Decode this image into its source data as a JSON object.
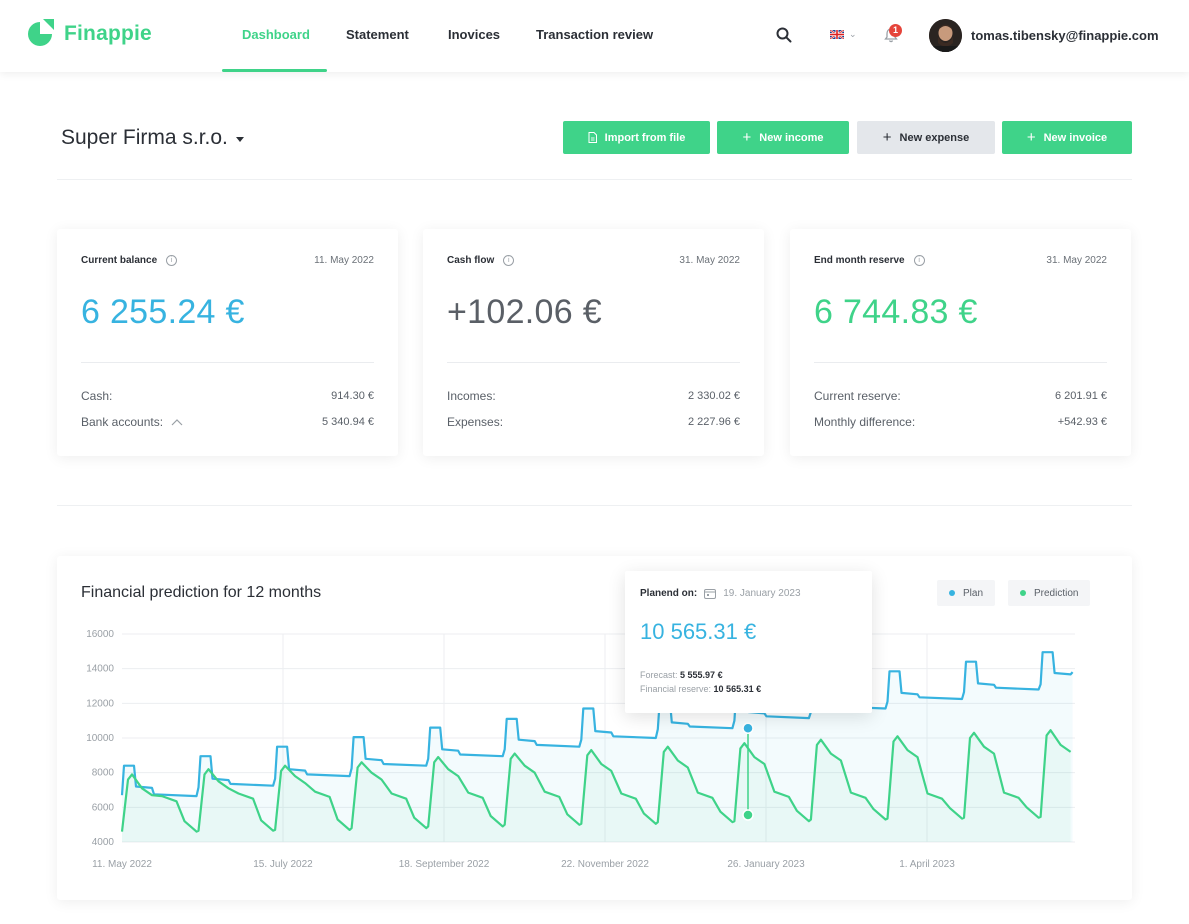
{
  "app": {
    "name": "Finappie",
    "brand_color": "#3fd389",
    "accent_blue": "#37b3e0"
  },
  "nav": {
    "items": [
      {
        "label": "Dashboard",
        "active": true
      },
      {
        "label": "Statement",
        "active": false
      },
      {
        "label": "Inovices",
        "active": false
      },
      {
        "label": "Transaction review",
        "active": false
      }
    ]
  },
  "header": {
    "search_icon": "search-icon",
    "language_icon": "uk-flag-icon",
    "notifications_count": "1",
    "user_email": "tomas.tibensky@finappie.com"
  },
  "company": {
    "name": "Super Firma s.r.o."
  },
  "actions": {
    "import": "Import from file",
    "new_income": "New income",
    "new_expense": "New expense",
    "new_invoice": "New invoice"
  },
  "cards": {
    "balance": {
      "title": "Current balance",
      "date": "11. May 2022",
      "value": "6 255.24 €",
      "color": "#37b3e0",
      "rows": [
        {
          "label": "Cash:",
          "value": "914.30 €"
        },
        {
          "label": "Bank accounts:",
          "value": "5 340.94 €"
        }
      ]
    },
    "cashflow": {
      "title": "Cash flow",
      "date": "31. May 2022",
      "value": "+102.06 €",
      "color": "#5a5f66",
      "rows": [
        {
          "label": "Incomes:",
          "value": "2 330.02 €"
        },
        {
          "label": "Expenses:",
          "value": "2 227.96 €"
        }
      ]
    },
    "reserve": {
      "title": "End month reserve",
      "date": "31. May 2022",
      "value": "6 744.83 €",
      "color": "#3fd389",
      "rows": [
        {
          "label": "Current reserve:",
          "value": "6 201.91 €"
        },
        {
          "label": "Monthly difference:",
          "value": "+542.93 €"
        }
      ]
    }
  },
  "chart": {
    "title": "Financial prediction for 12 months",
    "legend": {
      "plan": "Plan",
      "prediction": "Prediction"
    },
    "tooltip": {
      "label": "Planend on:",
      "date": "19. January 2023",
      "value": "10 565.31 €",
      "forecast_label": "Forecast:",
      "forecast_value": "5 555.97 €",
      "reserve_label": "Financial reserve:",
      "reserve_value": "10 565.31 €"
    }
  },
  "chart_data": {
    "type": "line",
    "title": "Financial prediction for 12 months",
    "ylim": [
      4000,
      16000
    ],
    "yticks": [
      16000,
      14000,
      12000,
      10000,
      8000,
      6000,
      4000
    ],
    "xticks": [
      "11. May 2022",
      "15. July 2022",
      "18. September 2022",
      "22. November 2022",
      "26. January 2023",
      "1. April 2023"
    ],
    "series": [
      {
        "name": "Plan",
        "color": "#37b3e0",
        "monthly": [
          {
            "start": 6700,
            "peak": 8400,
            "shoulder": 7200,
            "end": 6650
          },
          {
            "start": 7150,
            "peak": 8950,
            "shoulder": 7650,
            "end": 7250
          },
          {
            "start": 7650,
            "peak": 9500,
            "shoulder": 8200,
            "end": 7800
          },
          {
            "start": 8250,
            "peak": 10050,
            "shoulder": 8800,
            "end": 8400
          },
          {
            "start": 8800,
            "peak": 10600,
            "shoulder": 9350,
            "end": 8950
          },
          {
            "start": 9350,
            "peak": 11100,
            "shoulder": 9900,
            "end": 9500
          },
          {
            "start": 9900,
            "peak": 11700,
            "shoulder": 10400,
            "end": 10000
          },
          {
            "start": 10500,
            "peak": 12200,
            "shoulder": 10900,
            "end": 10565
          },
          {
            "start": 11000,
            "peak": 12800,
            "shoulder": 11500,
            "end": 11150
          },
          {
            "start": 11500,
            "peak": 13300,
            "shoulder": 12100,
            "end": 11700
          },
          {
            "start": 12100,
            "peak": 13850,
            "shoulder": 12600,
            "end": 12250
          },
          {
            "start": 12650,
            "peak": 14400,
            "shoulder": 13150,
            "end": 12800
          },
          {
            "start": 13100,
            "peak": 14950,
            "shoulder": 13750,
            "end": 13700
          }
        ]
      },
      {
        "name": "Prediction",
        "color": "#3fd389",
        "monthly": [
          {
            "low": 4600,
            "peak": 7900,
            "mid": 7100,
            "end": 6350
          },
          {
            "low": 4650,
            "peak": 8200,
            "mid": 7500,
            "end": 6500
          },
          {
            "low": 4700,
            "peak": 8400,
            "mid": 7800,
            "end": 6600
          },
          {
            "low": 4800,
            "peak": 8600,
            "mid": 8000,
            "end": 6500
          },
          {
            "low": 4900,
            "peak": 8900,
            "mid": 8200,
            "end": 6550
          },
          {
            "low": 5000,
            "peak": 9100,
            "mid": 8400,
            "end": 6600
          },
          {
            "low": 5050,
            "peak": 9300,
            "mid": 8500,
            "end": 6500
          },
          {
            "low": 5150,
            "peak": 9500,
            "mid": 8700,
            "end": 6550
          },
          {
            "low": 5200,
            "peak": 9700,
            "mid": 8900,
            "end": 6600
          },
          {
            "low": 5300,
            "peak": 9900,
            "mid": 9100,
            "end": 6550
          },
          {
            "low": 5350,
            "peak": 10100,
            "mid": 9300,
            "end": 6500
          },
          {
            "low": 5400,
            "peak": 10300,
            "mid": 9500,
            "end": 6550
          },
          {
            "low": 5450,
            "peak": 10450,
            "mid": 9600,
            "end": 9400
          }
        ]
      }
    ],
    "highlight": {
      "date": "19. January 2023",
      "plan": 10565.31,
      "prediction": 5555.97
    }
  }
}
